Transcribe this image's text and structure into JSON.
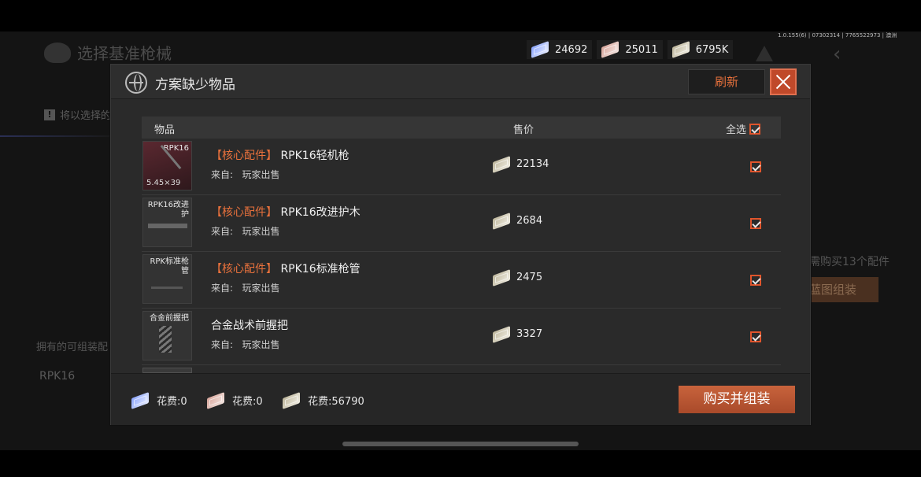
{
  "background": {
    "title": "选择基准枪械",
    "notice": "将以选择的",
    "owned_label": "拥有的可组装配",
    "weapon_label": "RPK16",
    "need_text": "需购买13个配件",
    "assemble_label": "蓝图组装",
    "version": "1.0.155(6) | 07302314 | 7765522973 | 澳洲"
  },
  "currency": [
    {
      "icon": "blue-banknote-icon",
      "value": "24692"
    },
    {
      "icon": "pink-banknote-icon",
      "value": "25011"
    },
    {
      "icon": "gold-banknote-icon",
      "value": "6795K"
    }
  ],
  "modal": {
    "title": "方案缺少物品",
    "refresh_label": "刷新",
    "columns": {
      "item": "物品",
      "price": "售价",
      "select_all": "全选"
    },
    "items": [
      {
        "thumb_name": "RPK16",
        "caliber": "5.45×39",
        "tag": "【核心配件】",
        "name": "RPK16轻机枪",
        "source_label": "来自:",
        "source": "玩家出售",
        "price": "22134",
        "checked": true
      },
      {
        "thumb_name": "RPK16改进护",
        "caliber": "",
        "tag": "【核心配件】",
        "name": "RPK16改进护木",
        "source_label": "来自:",
        "source": "玩家出售",
        "price": "2684",
        "checked": true
      },
      {
        "thumb_name": "RPK标准枪管",
        "caliber": "",
        "tag": "【核心配件】",
        "name": "RPK16标准枪管",
        "source_label": "来自:",
        "source": "玩家出售",
        "price": "2475",
        "checked": true
      },
      {
        "thumb_name": "合金前握把",
        "caliber": "",
        "tag": "",
        "name": "合金战术前握把",
        "source_label": "来自:",
        "source": "玩家出售",
        "price": "3327",
        "checked": true
      }
    ],
    "costs": [
      {
        "icon": "blue-banknote-icon",
        "label": "花费:0"
      },
      {
        "icon": "pink-banknote-icon",
        "label": "花费:0"
      },
      {
        "icon": "gold-banknote-icon",
        "label": "花费:56790"
      }
    ],
    "buy_label": "购买并组装"
  },
  "colors": {
    "accent": "#e8713c",
    "close_bg": "#c0492a",
    "panel": "#2a2a2a"
  }
}
